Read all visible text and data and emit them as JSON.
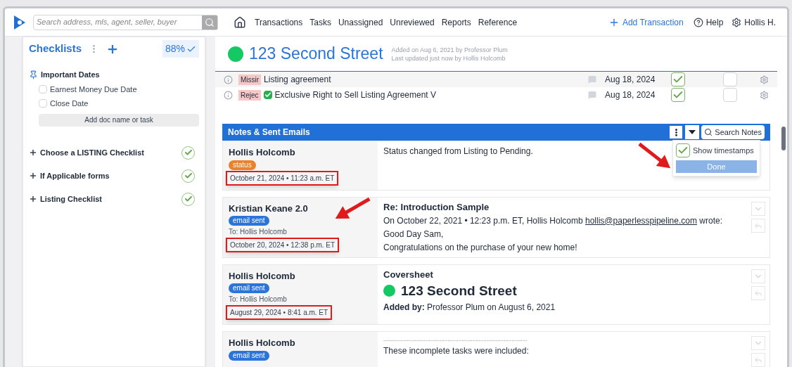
{
  "search": {
    "placeholder": "Search address, mls, agent, seller, buyer"
  },
  "nav": {
    "items": [
      "Transactions",
      "Tasks",
      "Unassigned",
      "Unreviewed",
      "Reports",
      "Reference"
    ],
    "add": "Add Transaction",
    "help": "Help",
    "user": "Hollis H."
  },
  "sidebar": {
    "title": "Checklists",
    "progress": "88%",
    "pinned": {
      "title": "Important Dates",
      "items": [
        {
          "label": "Earnest Money Due Date",
          "checked": false
        },
        {
          "label": "Close Date",
          "checked": false
        }
      ],
      "add": "Add doc name or task"
    },
    "groups": [
      {
        "label": "Choose a LISTING Checklist",
        "complete": true
      },
      {
        "label": "If Applicable forms",
        "complete": true
      },
      {
        "label": "Listing Checklist",
        "complete": true
      }
    ]
  },
  "transaction": {
    "title": "123 Second Street",
    "added": "Added on Aug 6, 2021 by Professor Plum",
    "updated": "Last updated just now by Hollis Holcomb"
  },
  "documents": [
    {
      "badge": "Missir",
      "name": "Listing agreement",
      "checked_name": false,
      "date": "Aug 18, 2024",
      "reviewed": true,
      "flag": false
    },
    {
      "badge": "Rejec",
      "name": "Exclusive Right to Sell Listing Agreement V",
      "checked_name": true,
      "date": "Aug 18, 2024",
      "reviewed": true,
      "flag": false
    }
  ],
  "notes_panel": {
    "title": "Notes & Sent Emails",
    "search": "Search Notes",
    "menu": {
      "option": "Show timestamps",
      "checked": true,
      "done": "Done"
    }
  },
  "notes": [
    {
      "kind": "status",
      "author": "Hollis Holcomb",
      "tag": "status",
      "timestamp": "October 21, 2024 • 11:23 a.m. ET",
      "highlighted": true,
      "body": [
        "Status changed from Listing to Pending."
      ]
    },
    {
      "kind": "email",
      "author": "Kristian Keane 2.0",
      "tag": "email sent",
      "to": "To: Hollis Holcomb",
      "timestamp": "October 20, 2024 • 12:38 p.m. ET",
      "highlighted": true,
      "subject": "Re: Introduction Sample",
      "quote": "On October 22, 2021 • 12:23 p.m. ET, Hollis Holcomb",
      "link": "hollis@paperlesspipeline.com",
      "quote_end": "wrote:",
      "body": [
        "Good Day Sam,",
        "Congratulations on the purchase of your new home!"
      ]
    },
    {
      "kind": "coversheet",
      "author": "Hollis Holcomb",
      "tag": "email sent",
      "to": "To: Hollis Holcomb",
      "timestamp": "August 29, 2024 • 8:41 a.m. ET",
      "highlighted": true,
      "subject": "Coversheet",
      "heading": "123 Second Street",
      "body": [
        "**Added by:** Professor Plum on August 6, 2021"
      ]
    },
    {
      "kind": "tasks",
      "author": "Hollis Holcomb",
      "tag": "email sent",
      "rule": "............................................................................................",
      "body": [
        "These incomplete tasks were included:"
      ]
    }
  ]
}
